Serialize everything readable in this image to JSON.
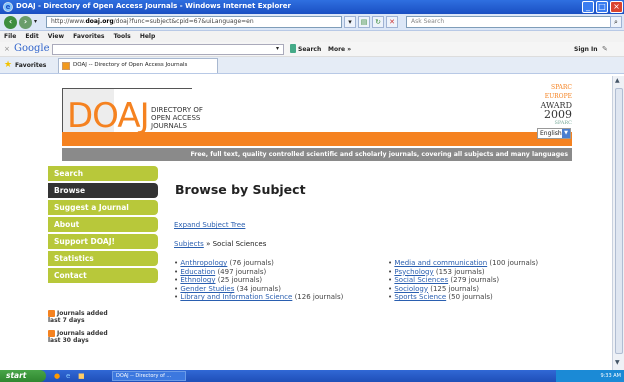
{
  "window": {
    "title": "DOAJ - Directory of Open Access Journals - Windows Internet Explorer"
  },
  "address": {
    "url_prefix": "http://www.",
    "url_domain": "doaj.org",
    "url_rest": "/doaj?func=subject&cpid=67&uiLanguage=en",
    "search_placeholder": "Ask Search"
  },
  "menu": [
    "File",
    "Edit",
    "View",
    "Favorites",
    "Tools",
    "Help"
  ],
  "google": {
    "label": "Google",
    "search_label": "Search",
    "more_label": "More »",
    "signin_label": "Sign In"
  },
  "favorites": {
    "label": "Favorites",
    "tab_title": "DOAJ -- Directory of Open Access Journals"
  },
  "logo": {
    "letters": "DOAJ",
    "line1": "DIRECTORY OF",
    "line2": "OPEN ACCESS",
    "line3": "JOURNALS"
  },
  "award": {
    "line1": "SPARC",
    "line2": "EUROPE",
    "line3": "AWARD",
    "year": "2009",
    "brand": "SPARC"
  },
  "language": {
    "selected": "English"
  },
  "tagline": "Free, full text, quality controlled scientific and scholarly journals, covering all subjects and many languages",
  "nav": [
    "Search",
    "Browse",
    "Suggest a Journal",
    "About",
    "Support DOAJ!",
    "Statistics",
    "Contact"
  ],
  "sidebar_links": {
    "last7": "Journals added last 7 days",
    "last30": "Journals added last 30 days"
  },
  "main": {
    "heading": "Browse by Subject",
    "expand": "Expand Subject Tree",
    "crumb_root": "Subjects",
    "crumb_sep": "»",
    "crumb_current": "Social Sciences",
    "left_subjects": [
      {
        "name": "Anthropology",
        "count": "(76 journals)"
      },
      {
        "name": "Education",
        "count": "(497 journals)"
      },
      {
        "name": "Ethnology",
        "count": "(25 journals)"
      },
      {
        "name": "Gender Studies",
        "count": "(34 journals)"
      },
      {
        "name": "Library and Information Science",
        "count": "(126 journals)"
      }
    ],
    "right_subjects": [
      {
        "name": "Media and communication",
        "count": "(100 journals)"
      },
      {
        "name": "Psychology",
        "count": "(153 journals)"
      },
      {
        "name": "Social Sciences",
        "count": "(279 journals)"
      },
      {
        "name": "Sociology",
        "count": "(125 journals)"
      },
      {
        "name": "Sports Science",
        "count": "(50 journals)"
      }
    ]
  },
  "taskbar": {
    "start": "start",
    "task": "DOAJ -- Directory of ...",
    "clock": "9:33 AM"
  },
  "colors": {
    "orange": "#f58220",
    "nav_green": "#b8c83a",
    "tagline_grey": "#8a8a8a"
  }
}
